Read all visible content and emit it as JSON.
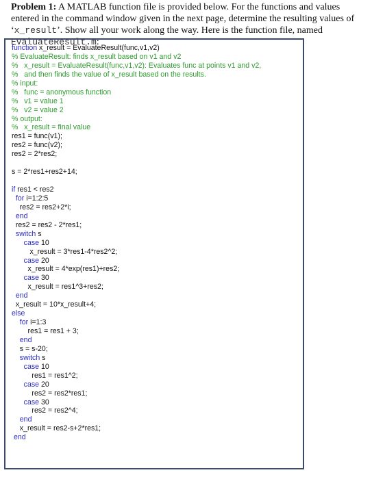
{
  "intro": {
    "bold": "Problem 1:",
    "text1": " A MATLAB function file is provided below. For the functions and values entered in the command window given in the next page, determine the resulting values of ‘",
    "mono1": "x_result",
    "text2": "’. Show all your work along the way. Here is the function file, named ",
    "mono2": "EvaluateResult.m",
    "text3": ":"
  },
  "colors": {
    "keyword": "#2b2bc4",
    "comment": "#2f9a2f",
    "border": "#3d4a68"
  },
  "code": [
    {
      "kw": "function",
      "text": " x_result = EvaluateResult(func,v1,v2)"
    },
    {
      "cm": "% EvaluateResult: finds x_result based on v1 and v2"
    },
    {
      "cm": "%   x_result = EvaluateResult(func,v1,v2): Evaluates func at points v1 and v2,"
    },
    {
      "cm": "%   and then finds the value of x_result based on the results."
    },
    {
      "cm": "% input:"
    },
    {
      "cm": "%   func = anonymous function"
    },
    {
      "cm": "%   v1 = value 1"
    },
    {
      "cm": "%   v2 = value 2"
    },
    {
      "cm": "% output:"
    },
    {
      "cm": "%   x_result = final value"
    },
    {
      "text": "res1 = func(v1);"
    },
    {
      "text": "res2 = func(v2);"
    },
    {
      "text": "res2 = 2*res2;"
    },
    {
      "text": ""
    },
    {
      "text": "s = 2*res1+res2+14;"
    },
    {
      "text": ""
    },
    {
      "kw": "if",
      "text": " res1 < res2"
    },
    {
      "pre": "  ",
      "kw": "for",
      "text": " i=1:2:5"
    },
    {
      "text": "    res2 = res2+2*i;"
    },
    {
      "pre": "  ",
      "kw": "end"
    },
    {
      "text": "  res2 = res2 - 2*res1;"
    },
    {
      "pre": "  ",
      "kw": "switch",
      "text": " s"
    },
    {
      "pre": "      ",
      "kw": "case",
      "text": " 10"
    },
    {
      "text": "         x_result = 3*res1-4*res2^2;"
    },
    {
      "pre": "      ",
      "kw": "case",
      "text": " 20"
    },
    {
      "text": "        x_result = 4*exp(res1)+res2;"
    },
    {
      "pre": "      ",
      "kw": "case",
      "text": " 30"
    },
    {
      "text": "        x_result = res1^3+res2;"
    },
    {
      "pre": "  ",
      "kw": "end"
    },
    {
      "text": "  x_result = 10*x_result+4;"
    },
    {
      "kw": "else"
    },
    {
      "pre": "    ",
      "kw": "for",
      "text": " i=1:3"
    },
    {
      "text": "        res1 = res1 + 3;"
    },
    {
      "pre": "    ",
      "kw": "end"
    },
    {
      "text": "    s = s-20;"
    },
    {
      "pre": "    ",
      "kw": "switch",
      "text": " s"
    },
    {
      "pre": "      ",
      "kw": "case",
      "text": " 10"
    },
    {
      "text": "          res1 = res1^2;"
    },
    {
      "pre": "      ",
      "kw": "case",
      "text": " 20"
    },
    {
      "text": "          res2 = res2*res1;"
    },
    {
      "pre": "      ",
      "kw": "case",
      "text": " 30"
    },
    {
      "text": "          res2 = res2^4;"
    },
    {
      "pre": "    ",
      "kw": "end"
    },
    {
      "text": "    x_result = res2-s+2*res1;"
    },
    {
      "pre": " ",
      "kw": "end"
    }
  ]
}
